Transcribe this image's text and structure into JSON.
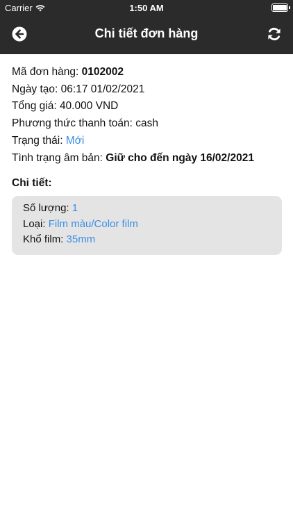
{
  "status_bar": {
    "carrier": "Carrier",
    "time": "1:50 AM"
  },
  "header": {
    "title": "Chi tiết đơn hàng",
    "back_icon": "circle-arrow-left-icon",
    "refresh_icon": "refresh-icon",
    "background": "#2b2b2b"
  },
  "order": {
    "code_label": "Mã đơn hàng: ",
    "code_value": "0102002",
    "created_label": "Ngày tạo: ",
    "created_value": "06:17 01/02/2021",
    "total_label": "Tổng giá: ",
    "total_value": "40.000 VND",
    "payment_label": "Phương thức thanh toán: ",
    "payment_value": "cash",
    "status_label": "Trạng thái: ",
    "status_value": "Mới",
    "negative_label": "Tình trạng âm bản: ",
    "negative_value": "Giữ cho đến ngày 16/02/2021"
  },
  "details": {
    "title": "Chi tiết:",
    "quantity_label": "Số lượng: ",
    "quantity_value": "1",
    "type_label": "Loại: ",
    "type_value": "Film màu/Color film",
    "size_label": "Khổ film: ",
    "size_value": "35mm"
  },
  "colors": {
    "accent": "#3a8ee6",
    "card": "#e4e4e4"
  }
}
